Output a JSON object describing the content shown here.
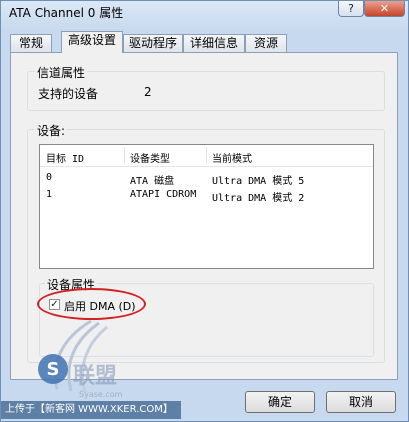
{
  "window": {
    "title": "ATA Channel 0 属性",
    "help_label": "?",
    "close_label": "✕"
  },
  "tabs": [
    {
      "label": "常规"
    },
    {
      "label": "高级设置"
    },
    {
      "label": "驱动程序"
    },
    {
      "label": "详细信息"
    },
    {
      "label": "资源"
    }
  ],
  "channel_props": {
    "title": "信道属性",
    "field_label": "支持的设备",
    "field_value": "2"
  },
  "devices": {
    "title": "设备:",
    "columns": [
      "目标 ID",
      "设备类型",
      "当前模式"
    ],
    "rows": [
      [
        "0",
        "ATA 磁盘",
        "Ultra DMA 模式 5"
      ],
      [
        "1",
        "ATAPI CDROM",
        "Ultra DMA 模式 2"
      ]
    ]
  },
  "device_props": {
    "title": "设备属性",
    "dma_label": "启用 DMA (D)",
    "dma_checked": true
  },
  "buttons": {
    "ok": "确定",
    "cancel": "取消"
  },
  "watermark": {
    "text": "上传于【新客网 WWW.XKER.COM】",
    "logo_text": "联盟",
    "logo_sub": "Syase.com"
  }
}
